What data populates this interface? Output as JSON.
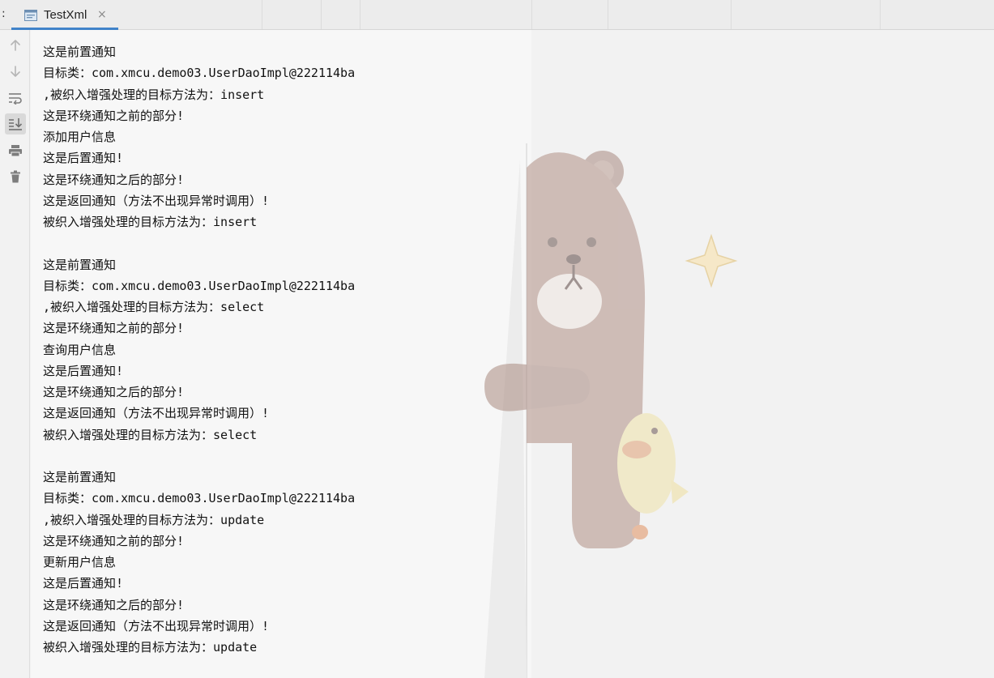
{
  "tabbar": {
    "prefix": ":",
    "tab": {
      "label": "TestXml",
      "close": "×"
    }
  },
  "toolbar": {
    "items": [
      {
        "icon": "arrow-up-icon"
      },
      {
        "icon": "arrow-down-icon"
      },
      {
        "icon": "soft-wrap-icon"
      },
      {
        "icon": "scroll-to-end-icon",
        "active": true
      },
      {
        "icon": "print-icon"
      },
      {
        "icon": "trash-icon"
      }
    ]
  },
  "console": {
    "lines": [
      "这是前置通知",
      "目标类：com.xmcu.demo03.UserDaoImpl@222114ba",
      ",被织入增强处理的目标方法为：insert",
      "这是环绕通知之前的部分!",
      "添加用户信息",
      "这是后置通知!",
      "这是环绕通知之后的部分!",
      "这是返回通知（方法不出现异常时调用）!",
      "被织入增强处理的目标方法为：insert",
      "",
      "这是前置通知",
      "目标类：com.xmcu.demo03.UserDaoImpl@222114ba",
      ",被织入增强处理的目标方法为：select",
      "这是环绕通知之前的部分!",
      "查询用户信息",
      "这是后置通知!",
      "这是环绕通知之后的部分!",
      "这是返回通知（方法不出现异常时调用）!",
      "被织入增强处理的目标方法为：select",
      "",
      "这是前置通知",
      "目标类：com.xmcu.demo03.UserDaoImpl@222114ba",
      ",被织入增强处理的目标方法为：update",
      "这是环绕通知之前的部分!",
      "更新用户信息",
      "这是后置通知!",
      "这是环绕通知之后的部分!",
      "这是返回通知（方法不出现异常时调用）!",
      "被织入增强处理的目标方法为：update"
    ]
  },
  "colors": {
    "accent": "#4083c9",
    "background": "#f2f2f2",
    "panel": "#f7f7f7",
    "text": "#111111",
    "icon": "#8c8c8c"
  }
}
